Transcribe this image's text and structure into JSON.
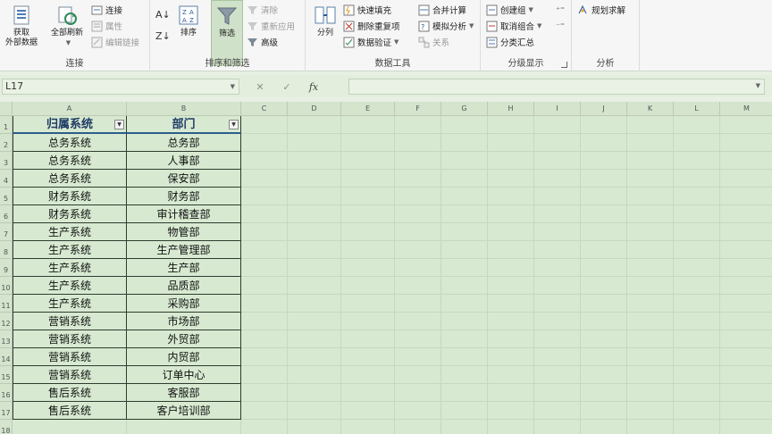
{
  "ribbon": {
    "groups": {
      "connect": {
        "label": "连接",
        "get_external": "获取\n外部数据",
        "refresh_all": "全部刷新",
        "connections": "连接",
        "properties": "属性",
        "edit_links": "编辑链接"
      },
      "sort_filter": {
        "label": "排序和筛选",
        "sort": "排序",
        "filter": "筛选",
        "clear": "清除",
        "reapply": "重新应用",
        "advanced": "高级"
      },
      "data_tools": {
        "label": "数据工具",
        "text_to_columns": "分列",
        "flash_fill": "快速填充",
        "remove_duplicates": "删除重复项",
        "data_validation": "数据验证",
        "consolidate": "合并计算",
        "what_if": "模拟分析",
        "relationships": "关系"
      },
      "outline": {
        "label": "分级显示",
        "group": "创建组",
        "ungroup": "取消组合",
        "subtotal": "分类汇总"
      },
      "analysis": {
        "label": "分析",
        "solver": "规划求解"
      }
    }
  },
  "formula_bar": {
    "name_box": "L17",
    "fx": "fx",
    "formula": ""
  },
  "columns": [
    "A",
    "B",
    "C",
    "D",
    "E",
    "F",
    "G",
    "H",
    "I",
    "J",
    "K",
    "L",
    "M"
  ],
  "rows": [
    "1",
    "2",
    "3",
    "4",
    "5",
    "6",
    "7",
    "8",
    "9",
    "10",
    "11",
    "12",
    "13",
    "14",
    "15",
    "16",
    "17",
    "18"
  ],
  "table": {
    "headers": [
      "归属系统",
      "部门"
    ],
    "rows": [
      [
        "总务系统",
        "总务部"
      ],
      [
        "总务系统",
        "人事部"
      ],
      [
        "总务系统",
        "保安部"
      ],
      [
        "财务系统",
        "财务部"
      ],
      [
        "财务系统",
        "审计稽查部"
      ],
      [
        "生产系统",
        "物管部"
      ],
      [
        "生产系统",
        "生产管理部"
      ],
      [
        "生产系统",
        "生产部"
      ],
      [
        "生产系统",
        "品质部"
      ],
      [
        "生产系统",
        "采购部"
      ],
      [
        "营销系统",
        "市场部"
      ],
      [
        "营销系统",
        "外贸部"
      ],
      [
        "营销系统",
        "内贸部"
      ],
      [
        "营销系统",
        "订单中心"
      ],
      [
        "售后系统",
        "客服部"
      ],
      [
        "售后系统",
        "客户培训部"
      ]
    ]
  }
}
